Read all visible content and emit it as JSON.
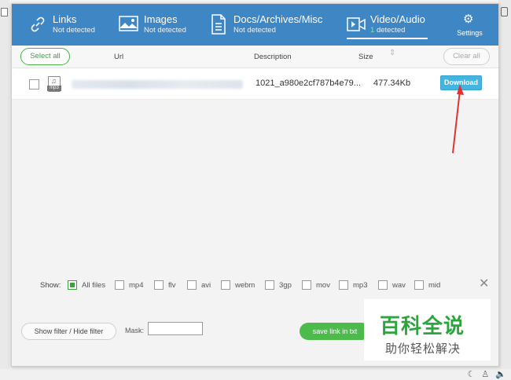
{
  "tabs": [
    {
      "name": "Links",
      "status": "Not detected",
      "count": ""
    },
    {
      "name": "Images",
      "status": "Not detected",
      "count": ""
    },
    {
      "name": "Docs/Archives/Misc",
      "status": "Not detected",
      "count": ""
    },
    {
      "name": "Video/Audio",
      "status": "detected",
      "count": "1"
    }
  ],
  "settings_label": "Settings",
  "columns": {
    "select_all": "Select all",
    "url": "Url",
    "description": "Description",
    "size": "Size",
    "clear_all": "Clear all"
  },
  "rows": [
    {
      "file_type": "mp3",
      "description": "1021_a980e2cf787b4e79...",
      "size": "477.34Kb",
      "action": "Download"
    }
  ],
  "filters": {
    "show_label": "Show:",
    "options": [
      {
        "label": "All files",
        "checked": true
      },
      {
        "label": "mp4",
        "checked": false
      },
      {
        "label": "flv",
        "checked": false
      },
      {
        "label": "avi",
        "checked": false
      },
      {
        "label": "webm",
        "checked": false
      },
      {
        "label": "3gp",
        "checked": false
      },
      {
        "label": "mov",
        "checked": false
      },
      {
        "label": "mp3",
        "checked": false
      },
      {
        "label": "wav",
        "checked": false
      },
      {
        "label": "mid",
        "checked": false
      }
    ]
  },
  "bottom": {
    "show_filter": "Show filter / Hide filter",
    "mask_label": "Mask:",
    "mask_value": "",
    "save_link": "save link in txt"
  },
  "watermark": {
    "title": "百科全说",
    "subtitle": "助你轻松解决"
  },
  "colors": {
    "header": "#3f86c4",
    "accent_green": "#3aa13a",
    "download": "#43b5e0",
    "arrow": "#e0342f"
  }
}
